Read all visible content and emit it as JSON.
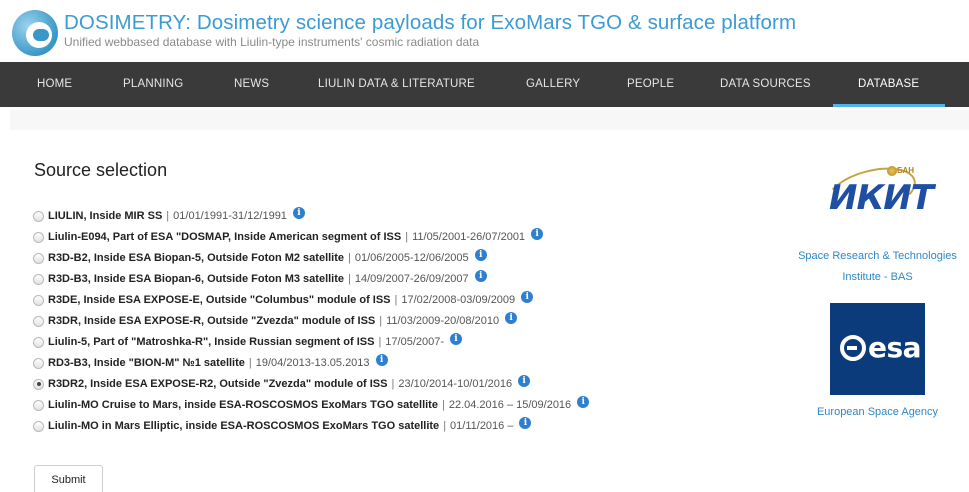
{
  "header": {
    "title": "DOSIMETRY: Dosimetry science payloads for ExoMars TGO & surface platform",
    "subtitle": "Unified webbased database with Liulin-type instruments' cosmic radiation data"
  },
  "nav": {
    "items": [
      "HOME",
      "PLANNING",
      "NEWS",
      "LIULIN DATA & LITERATURE",
      "GALLERY",
      "PEOPLE",
      "DATA SOURCES",
      "DATABASE"
    ],
    "active": "DATABASE"
  },
  "main": {
    "section_title": "Source selection",
    "sources": [
      {
        "name": "LIULIN, Inside MIR SS",
        "dates": "01/01/1991-31/12/1991",
        "checked": false
      },
      {
        "name": "Liulin-E094, Part of ESA \"DOSMAP, Inside American segment of ISS",
        "dates": "11/05/2001-26/07/2001",
        "checked": false
      },
      {
        "name": "R3D-B2, Inside ESA Biopan-5, Outside Foton M2 satellite",
        "dates": "01/06/2005-12/06/2005",
        "checked": false
      },
      {
        "name": "R3D-B3, Inside ESA Biopan-6, Outside Foton M3 satellite",
        "dates": "14/09/2007-26/09/2007",
        "checked": false
      },
      {
        "name": "R3DE, Inside ESA EXPOSE-E, Outside \"Columbus\" module of ISS",
        "dates": "17/02/2008-03/09/2009",
        "checked": false
      },
      {
        "name": "R3DR, Inside ESA EXPOSE-R, Outside \"Zvezda\" module of ISS",
        "dates": "11/03/2009-20/08/2010",
        "checked": false
      },
      {
        "name": "Liulin-5, Part of \"Matroshka-R\", Inside Russian segment of ISS",
        "dates": "17/05/2007-",
        "checked": false
      },
      {
        "name": "RD3-B3, Inside \"BION-M\" №1 satellite",
        "dates": "19/04/2013-13.05.2013",
        "checked": false
      },
      {
        "name": "R3DR2, Inside ESA EXPOSE-R2, Outside \"Zvezda\" module of ISS",
        "dates": "23/10/2014-10/01/2016",
        "checked": true
      },
      {
        "name": "Liulin-MO Cruise to Mars, inside ESA-ROSCOSMOS ExoMars TGO satellite",
        "dates": "22.04.2016 – 15/09/2016",
        "checked": false
      },
      {
        "name": "Liulin-MO in Mars Elliptic, inside ESA-ROSCOSMOS ExoMars TGO satellite",
        "dates": "01/11/2016 –",
        "checked": false
      }
    ],
    "separator": "|",
    "info_glyph": "i",
    "submit_label": "Submit"
  },
  "sidebar": {
    "ikit_logo_text": "ИКИТ",
    "ikit_badge": "БАН",
    "ikit_label_line1": "Space Research & Technologies",
    "ikit_label_line2": "Institute - BAS",
    "esa_logo_text": "esa",
    "esa_label": "European Space Agency"
  },
  "colors": {
    "accent": "#3b9bd3",
    "navbar": "#3a3a3a",
    "nav_underline": "#52b3e6",
    "info_icon": "#2f7fd1",
    "esa_blue": "#0c3b7c"
  }
}
